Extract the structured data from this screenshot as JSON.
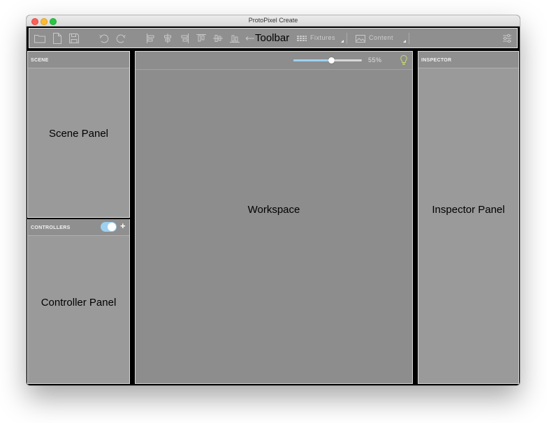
{
  "window": {
    "title": "ProtoPixel Create"
  },
  "toolbar": {
    "label": "Toolbar",
    "fixtures_label": "Fixtures",
    "content_label": "Content"
  },
  "scene": {
    "header": "SCENE",
    "label": "Scene Panel"
  },
  "controllers": {
    "header": "CONTROLLERS",
    "label": "Controller Panel",
    "toggle_on": true
  },
  "workspace": {
    "label": "Workspace",
    "zoom_text": "55%",
    "zoom_value": 55
  },
  "inspector": {
    "header": "INSPECTOR",
    "label": "Inspector Panel"
  },
  "colors": {
    "accent": "#9ed0f0",
    "panel": "#9a9a9a",
    "workspace": "#8d8d8d"
  }
}
